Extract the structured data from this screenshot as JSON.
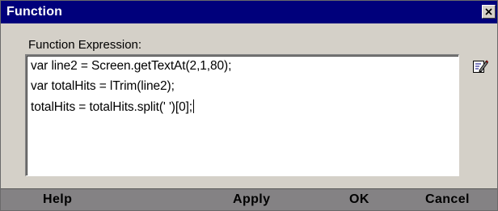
{
  "window": {
    "title": "Function"
  },
  "editor": {
    "label": "Function Expression:",
    "lines": [
      "var line2 = Screen.getTextAt(2,1,80);",
      "var totalHits = lTrim(line2);",
      "totalHits = totalHits.split(' ')[0];"
    ]
  },
  "icons": {
    "close": "close-icon",
    "edit": "edit-expression-icon"
  },
  "buttons": {
    "help": "Help",
    "apply": "Apply",
    "ok": "OK",
    "cancel": "Cancel"
  },
  "colors": {
    "title_bar": "#00007b",
    "dialog_bg": "#d4d0c8",
    "button_bar": "#848284"
  }
}
